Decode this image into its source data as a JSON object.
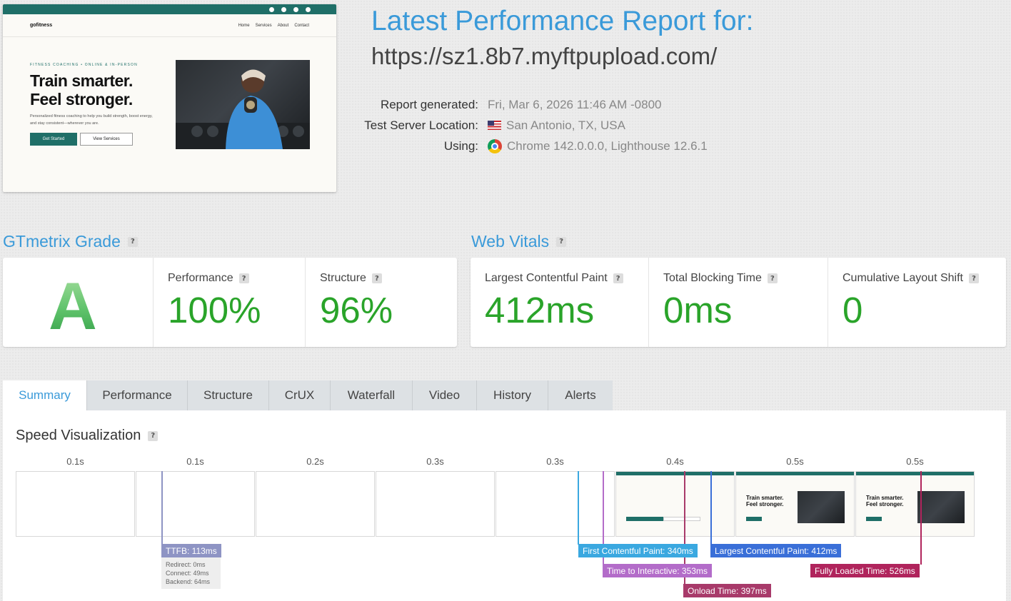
{
  "preview": {
    "logo": "gofitness",
    "nav_links": [
      "Home",
      "Services",
      "About",
      "Contact"
    ],
    "eyebrow": "FITNESS COACHING • ONLINE & IN-PERSON",
    "headline_1": "Train smarter.",
    "headline_2": "Feel stronger.",
    "subtext": "Personalized fitness coaching to help you build strength, boost energy, and stay consistent—wherever you are.",
    "primary_button": "Get Started",
    "secondary_button": "View Services"
  },
  "header": {
    "title": "Latest Performance Report for:",
    "url": "https://sz1.8b7.myftpupload.com/",
    "report_generated_label": "Report generated:",
    "report_generated_value": "Fri, Mar 6, 2026 11:46 AM -0800",
    "location_label": "Test Server Location:",
    "location_value": "San Antonio, TX, USA",
    "using_label": "Using:",
    "using_value": "Chrome 142.0.0.0, Lighthouse 12.6.1"
  },
  "grade": {
    "heading": "GTmetrix Grade",
    "letter": "A",
    "performance_label": "Performance",
    "performance_value": "100%",
    "structure_label": "Structure",
    "structure_value": "96%"
  },
  "vitals": {
    "heading": "Web Vitals",
    "lcp_label": "Largest Contentful Paint",
    "lcp_value": "412ms",
    "tbt_label": "Total Blocking Time",
    "tbt_value": "0ms",
    "cls_label": "Cumulative Layout Shift",
    "cls_value": "0"
  },
  "tabs": [
    "Summary",
    "Performance",
    "Structure",
    "CrUX",
    "Waterfall",
    "Video",
    "History",
    "Alerts"
  ],
  "speed": {
    "heading": "Speed Visualization",
    "frame_labels": [
      "0.1s",
      "0.1s",
      "0.2s",
      "0.3s",
      "0.3s",
      "0.4s",
      "0.5s",
      "0.5s"
    ],
    "ttfb": "TTFB: 113ms",
    "ttfb_redirect": "Redirect: 0ms",
    "ttfb_connect": "Connect: 49ms",
    "ttfb_backend": "Backend: 64ms",
    "fcp": "First Contentful Paint: 340ms",
    "lcp": "Largest Contentful Paint: 412ms",
    "tti": "Time to Interactive: 353ms",
    "fully_loaded": "Fully Loaded Time: 526ms",
    "onload": "Onload Time: 397ms",
    "mini_headline_1": "Train smarter.",
    "mini_headline_2": "Feel stronger."
  },
  "colors": {
    "accent": "#3a9ad9",
    "good": "#2aa42a",
    "ttfb": "#8e94c4",
    "fcp": "#3aa8e0",
    "lcp": "#3a6fd8",
    "tti": "#b36cc9",
    "onload": "#a83a6a",
    "fully_loaded": "#b0245c"
  }
}
